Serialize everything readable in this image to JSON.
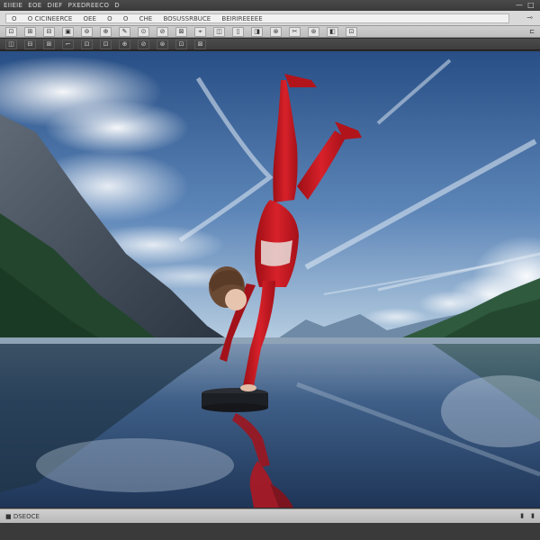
{
  "titlebar": {
    "menu": [
      "EIIEIE",
      "EOE",
      "DIEF",
      "PXEDREECO",
      "D"
    ],
    "window_controls": [
      "—",
      "□"
    ]
  },
  "addressbar": {
    "segments": [
      "O",
      "O CICINEERCE",
      "OEE",
      "O",
      "O",
      "CHE",
      "BOSUSSRBUCE",
      "BEIRIREEEEE"
    ],
    "right_glyph": "⊸"
  },
  "toolbar1": {
    "buttons": [
      "⊡",
      "⊞",
      "⊟",
      "▣",
      "⊚",
      "⊕",
      "✎",
      "⊙",
      "⊘",
      "⊠",
      "⌖",
      "◫",
      "▯",
      "◨",
      "⊗",
      "✂",
      "⊛",
      "◧",
      "⊡"
    ],
    "right_glyph": "⊏"
  },
  "toolbar2": {
    "buttons": [
      "◫",
      "⊟",
      "⊞",
      "⌐",
      "⊡",
      "⊡",
      "⊕",
      "⊘",
      "⊛",
      "⊡",
      "⊠"
    ]
  },
  "canvas": {
    "description_icon": "image-icon",
    "colors": {
      "sky_top": "#2f5a91",
      "sky_bottom": "#a9c4dd",
      "water": "#3d5c83",
      "figure": "#c4161c",
      "mountain": "#4d5a68"
    }
  },
  "statusbar": {
    "left_text": "■ DSEOCE",
    "right_glyphs": [
      "▮",
      "▮"
    ]
  }
}
